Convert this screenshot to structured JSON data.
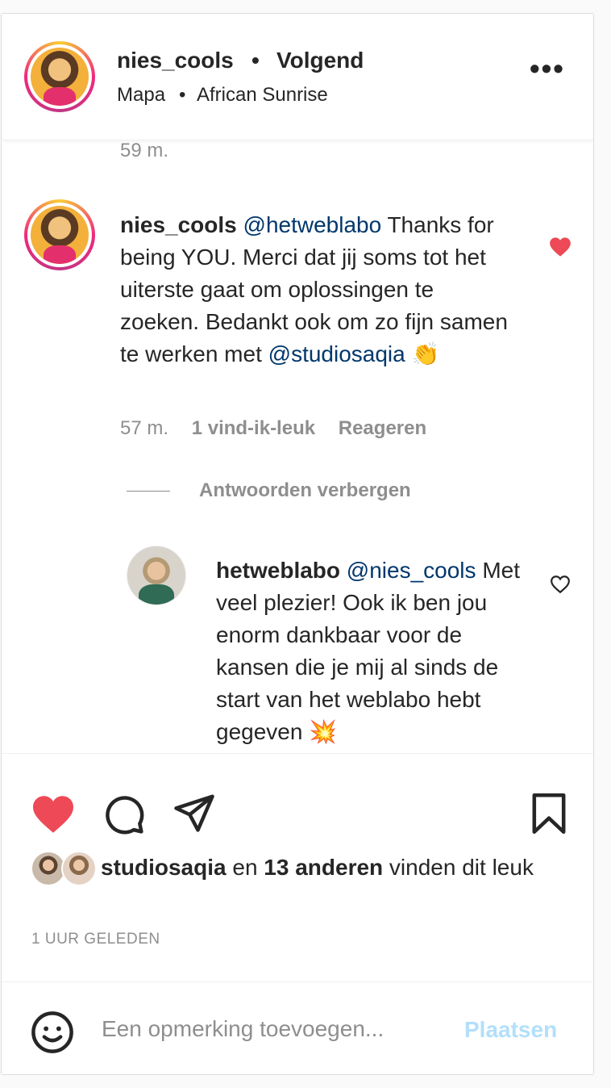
{
  "header": {
    "username": "nies_cools",
    "separator": "•",
    "follow_status": "Volgend",
    "location_1": "Mapa",
    "location_separator": "•",
    "location_2": "African Sunrise",
    "more_icon": "more-options-icon",
    "more_label": "•••"
  },
  "comments": {
    "previous_time": "59 m.",
    "main_comment": {
      "username": "nies_cools",
      "mention_1": "@hetweblabo",
      "text_1": " Thanks for being YOU. Merci dat jij soms tot het uiterste gaat om oplossingen te zoeken. Bedankt ook om zo fijn samen te werken met ",
      "mention_2": "@studiosaqia",
      "emoji": "👏",
      "time": "57 m.",
      "likes": "1 vind-ik-leuk",
      "reply_label": "Reageren",
      "liked": true
    },
    "hide_replies_label": "Antwoorden verbergen",
    "reply": {
      "username": "hetweblabo",
      "mention": "@nies_cools",
      "text": "Met veel plezier! Ook ik ben jou enorm dankbaar voor de kansen die je mij al sinds de start van het weblabo hebt gegeven ",
      "emoji": "💥",
      "liked": false
    }
  },
  "actions": {
    "like_icon": "heart-filled-icon",
    "comment_icon": "comment-icon",
    "share_icon": "share-icon",
    "save_icon": "bookmark-icon",
    "liked_by_user": "studiosaqia",
    "liked_by_middle": " en ",
    "liked_by_count": "13 anderen",
    "liked_by_suffix": " vinden dit leuk",
    "time_ago": "1 UUR GELEDEN"
  },
  "add_comment": {
    "emoji_icon": "smiley-icon",
    "placeholder": "Een opmerking toevoegen...",
    "post_label": "Plaatsen"
  },
  "colors": {
    "like_red": "#ed4956",
    "mention_blue": "#00376b",
    "post_button_disabled": "#b2dffc",
    "meta_gray": "#8e8e8e"
  }
}
